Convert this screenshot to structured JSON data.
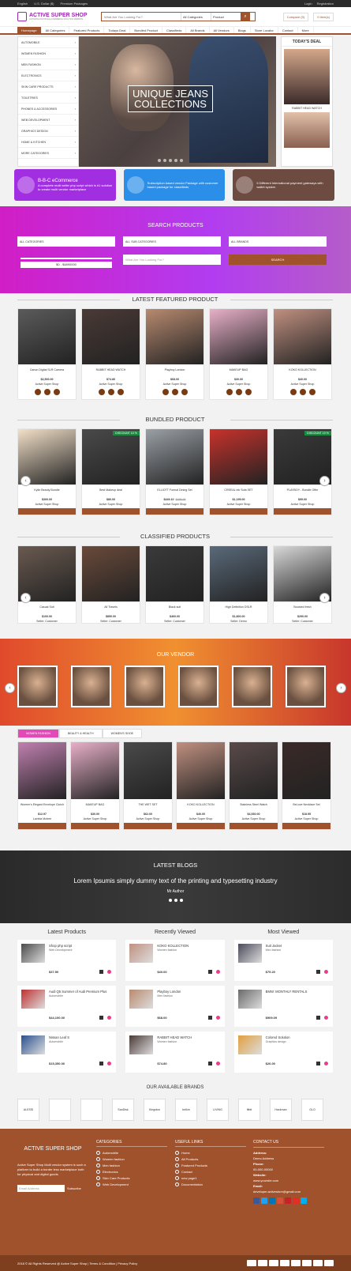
{
  "topbar": {
    "lang": "English",
    "currency": "U.S. Dollar ($)",
    "premium": "Premium Packages",
    "login": "Login",
    "register": "Registration"
  },
  "header": {
    "brand": "ACTIVE SUPER SHOP",
    "tagline": "ULTIMATE MULTIPLE E-COMMERCE SOLUTION WEBSITE",
    "search_placeholder": "What Are You Looking For?",
    "category": "All Categories",
    "type": "Product",
    "compare": "Compare (0)",
    "items": "0 Item(s)"
  },
  "nav": [
    "Homepage",
    "All Categories",
    "Featured Products",
    "Todays Deal",
    "Bundled Product",
    "Classifieds",
    "All Brands",
    "All Vendors",
    "Blogs",
    "Store Locator",
    "Contact",
    "More"
  ],
  "categories": [
    "AUTOMOBILE",
    "WOMEN FASHION",
    "MEN FASHION",
    "ELECTRONICS",
    "SKIN CARE PRODUCTS",
    "TOILETRIES",
    "PHONES & ACCESSORIES",
    "WEB DEVELOPMENT",
    "GRAPHICS DESIGN",
    "HOME & KITCHEN",
    "MORE CATEGORIES"
  ],
  "hero": {
    "line1": "UNIQUE JEANS",
    "line2": "COLLECTIONS"
  },
  "deal": {
    "title": "TODAY'S DEAL",
    "item": "RABBIT HEAD WATCH"
  },
  "promos": [
    {
      "text": "B-B-C eCommerce",
      "sub": "A complete multi seller php script which is #1 solution to create multi vendor marketplace",
      "color": "#a12ee0"
    },
    {
      "text": "Subscription based vendor Package with customer based package for classifieds",
      "color": "#2b8ee8"
    },
    {
      "text": "5 Different International payment gateways with wallet system",
      "color": "#6d4b40"
    }
  ],
  "search_products": {
    "title": "SEARCH PRODUCTS",
    "cat": "ALL CATEGORIES",
    "sub": "ALL SUB CATEGORIES",
    "brand": "ALL BRANDS",
    "range": "$0 - $4890000",
    "placeholder": "What Are You Looking For?",
    "button": "SEARCH"
  },
  "sections": {
    "featured": "LATEST FEATURED PRODUCT",
    "bundled": "BUNDLED PRODUCT",
    "classified": "CLASSIFIED PRODUCTS",
    "vendor": "OUR VENDOR",
    "blogs": "LATEST BLOGS",
    "brands": "OUR AVAILABLE BRANDS"
  },
  "featured": [
    {
      "name": "Canon Digital SLR Camera",
      "price": "$3,500.00",
      "store": "Active Super Shop",
      "color": "#5b5b5b"
    },
    {
      "name": "RABBIT HEAD WATCH",
      "price": "$74.80",
      "store": "Active Super Shop",
      "color": "#4a3a36"
    },
    {
      "name": "Playboy London",
      "price": "$68.00",
      "store": "Active Super Shop",
      "color": "#b88a70"
    },
    {
      "name": "MAKEUP BAG",
      "price": "$30.00",
      "store": "Active Super Shop",
      "color": "#e8b0c8"
    },
    {
      "name": "KOKO KOLLECTION",
      "price": "$40.00",
      "store": "Active Super Shop",
      "color": "#c09080"
    }
  ],
  "bundled": [
    {
      "name": "Kylie Beauty Bundle",
      "price": "$300.00",
      "store": "Active Super Shop",
      "color": "#f3e0c8"
    },
    {
      "name": "Best Makeup deal",
      "price": "$80.00",
      "store": "Active Super Shop",
      "color": "#4a4a4a"
    },
    {
      "name": "ELLIOTT Formal Dining Set",
      "price": "$449.10",
      "old": "$499.00",
      "store": "Active Super Shop",
      "color": "#9aa0a6"
    },
    {
      "name": "CREEAL ink Sofa SET",
      "price": "$1,199.00",
      "store": "Active Super Shop",
      "color": "#c8322c"
    },
    {
      "name": "PLAYBOY - Bundle Offer",
      "price": "$99.00",
      "store": "Active Super Shop",
      "color": "#3a3a3a"
    }
  ],
  "discount": "DISCOUNT 10 %",
  "classified": [
    {
      "name": "Casual Suit",
      "price": "$100.00",
      "store": "Seller: Customer",
      "color": "#6a5a50"
    },
    {
      "name": "All Travels",
      "price": "$850.00",
      "store": "Seller: Customer",
      "color": "#6a4a3a"
    },
    {
      "name": "Black suit",
      "price": "$460.00",
      "store": "Seller: Customer",
      "color": "#3a3a3a"
    },
    {
      "name": "High Definition DSLR",
      "price": "$1,800.00",
      "store": "Seller: Demo",
      "color": "#5a6a7a"
    },
    {
      "name": "Boosted fresh",
      "price": "$290.00",
      "store": "Seller: Customer",
      "color": "#d8d8d8"
    }
  ],
  "tabs": [
    "WOMEN FASHION",
    "BEAUTY & HEALTH",
    "WOMEN'S SHOE"
  ],
  "tabitems": [
    {
      "name": "Women's Elegant Envelope Clutch",
      "price": "$12.97",
      "store": "Lavinia Mcbee",
      "color": "#c080b0"
    },
    {
      "name": "MAKEUP BAG",
      "price": "$30.00",
      "store": "Active Super Shop",
      "color": "#e8b0c8"
    },
    {
      "name": "THE WET SET",
      "price": "$62.00",
      "store": "Active Super Shop",
      "color": "#4a4a4a"
    },
    {
      "name": "KOKO KOLLECTION",
      "price": "$40.00",
      "store": "Active Super Shop",
      "color": "#c09080"
    },
    {
      "name": "Stainless Steel Watch",
      "price": "$4,530.00",
      "store": "Active Super Shop",
      "color": "#5a4a4a"
    },
    {
      "name": "BeLove Necklace Set",
      "price": "$18.95",
      "store": "Active Super Shop",
      "color": "#3a2a28"
    }
  ],
  "blog": {
    "quote": "Lorem Ipsumis simply dummy text of the printing and typesetting industry",
    "author": "Mr Author"
  },
  "lists": [
    {
      "title": "Latest Products",
      "items": [
        {
          "name": "Shop php script",
          "cat": "Web Development",
          "price": "$37.50",
          "color": "#4a4a4a"
        },
        {
          "name": "Audi Q5 Summer of Audi Premium Plus",
          "cat": "Automobile",
          "price": "$44,100.00",
          "color": "#c03030"
        },
        {
          "name": "Nissan Leaf S",
          "cat": "Automobile",
          "price": "$15,350.00",
          "color": "#2a5090"
        }
      ]
    },
    {
      "title": "Recently Viewed",
      "items": [
        {
          "name": "KOKO KOLLECTION",
          "cat": "Women fashion",
          "price": "$40.00",
          "color": "#c09080"
        },
        {
          "name": "Playboy London",
          "cat": "Men fashion",
          "price": "$68.00",
          "color": "#b88a70"
        },
        {
          "name": "RABBIT HEAD WATCH",
          "cat": "Women fashion",
          "price": "$74.80",
          "color": "#4a3a36"
        }
      ]
    },
    {
      "title": "Most Viewed",
      "items": [
        {
          "name": "Suit Jacket",
          "cat": "Men fashion",
          "price": "$79.20",
          "color": "#4a4a5a"
        },
        {
          "name": "BMW: MONTHLY RENTALS",
          "cat": "",
          "price": "$909.09",
          "color": "#6a6a6a"
        },
        {
          "name": "Colored Solution",
          "cat": "Graphics design",
          "price": "$26.00",
          "color": "#e0a040"
        }
      ]
    }
  ],
  "add_to_list": "Add To List",
  "brands": [
    "ALESSI",
    "",
    "",
    "SanDisk",
    "Kingston",
    "belkin",
    "LIVING",
    "fitbit",
    "Hackman",
    "GLO"
  ],
  "footer": {
    "brand": "ACTIVE SUPER SHOP",
    "desc": "Active Super Shop Multi vendor system is such a platform to build a border less marketplace both for physical and digital goods.",
    "email_placeholder": "Email Address",
    "subscribe": "Subscribe",
    "cat_title": "CATEGORIES",
    "cats": [
      "Automobile",
      "Women fashion",
      "Men fashion",
      "Electronics",
      "Skin Care Products",
      "Web Development"
    ],
    "links_title": "USEFUL LINKS",
    "links": [
      "Home",
      "All Products",
      "Featured Products",
      "Contact",
      "new page1",
      "Documentation"
    ],
    "contact_title": "CONTACT US",
    "address_label": "Address:",
    "address": "Demo Address",
    "phone_label": "Phone:",
    "phone": "00-000-00000",
    "web_label": "Website:",
    "web": "www.yoursite.com",
    "email_label": "Email:",
    "email": "developer.activestore@gmail.com",
    "copyright": "2018 © All Rights Reserved @ Active Super Shop | Terms & Condition | Privacy Policy"
  }
}
